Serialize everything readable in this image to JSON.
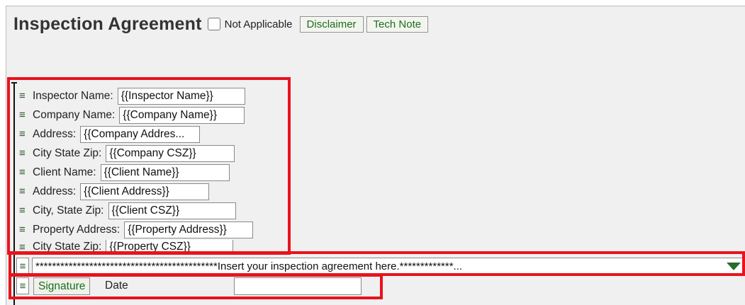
{
  "header": {
    "title": "Inspection Agreement",
    "not_applicable_label": "Not Applicable",
    "disclaimer_button": "Disclaimer",
    "tech_note_button": "Tech Note"
  },
  "grip_glyph": "≡",
  "fields": [
    {
      "label": "Inspector Name:",
      "value": "{{Inspector Name}}"
    },
    {
      "label": "Company Name:",
      "value": "{{Company Name}}"
    },
    {
      "label": "Address:",
      "value": "{{Company Addres..."
    },
    {
      "label": "City State Zip:",
      "value": "{{Company CSZ}}"
    },
    {
      "label": "Client Name:",
      "value": "{{Client Name}}"
    },
    {
      "label": "Address:",
      "value": "{{Client Address}}"
    },
    {
      "label": "City, State Zip:",
      "value": "{{Client CSZ}}"
    },
    {
      "label": "Property Address:",
      "value": "{{Property Address}}"
    },
    {
      "label": "City State Zip:",
      "value": "{{Property CSZ}}"
    }
  ],
  "agreement": {
    "text": "********************************************Insert your inspection agreement here.*************..."
  },
  "signature": {
    "button": "Signature",
    "date_label": "Date",
    "date_value": ""
  },
  "colors": {
    "highlight": "#e8131c",
    "button_text": "#1f6b1f",
    "panel_bg": "#f0f0f0"
  }
}
